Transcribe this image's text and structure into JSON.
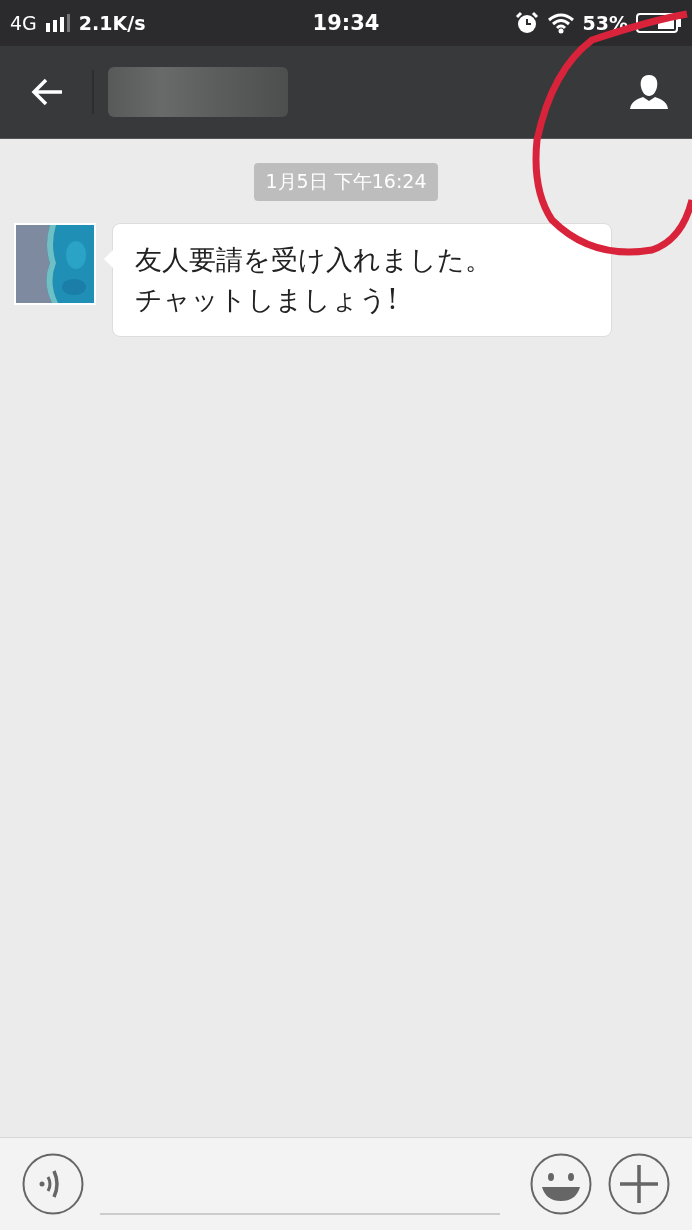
{
  "status_bar": {
    "network": "4G",
    "speed": "2.1K/s",
    "time": "19:34",
    "battery": "53%"
  },
  "chat": {
    "timestamp": "1月5日 下午16:24",
    "messages": [
      {
        "kind": "incoming",
        "lines": [
          "友人要請を受け入れました。",
          "チャットしましょう!"
        ]
      }
    ]
  },
  "annotation": {
    "kind": "circle"
  }
}
